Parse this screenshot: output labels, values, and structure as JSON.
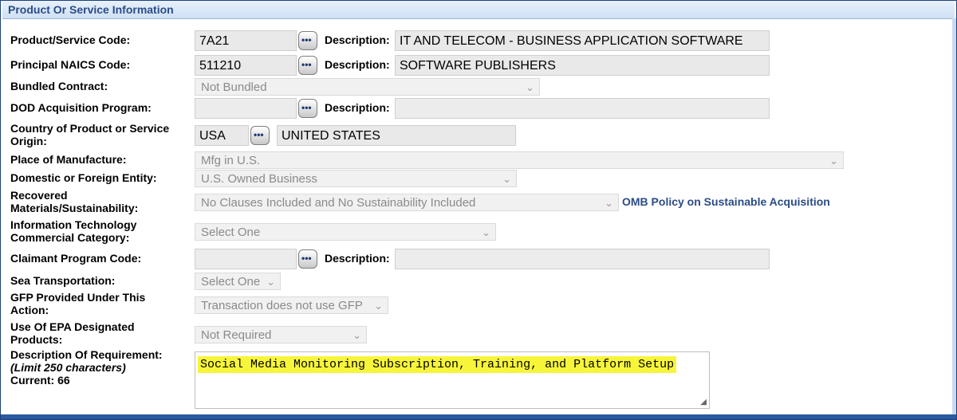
{
  "section": {
    "title": "Product Or Service Information"
  },
  "psc": {
    "label": "Product/Service Code:",
    "value": "7A21",
    "desc_label": "Description:",
    "desc": "IT AND TELECOM - BUSINESS APPLICATION SOFTWARE"
  },
  "naics": {
    "label": "Principal NAICS Code:",
    "value": "511210",
    "desc_label": "Description:",
    "desc": "SOFTWARE PUBLISHERS"
  },
  "bundled": {
    "label": "Bundled Contract:",
    "value": "Not Bundled"
  },
  "dod": {
    "label": "DOD Acquisition Program:",
    "value": "",
    "desc_label": "Description:",
    "desc": ""
  },
  "country": {
    "label_line1": "Country of Product or Service",
    "label_line2": "Origin:",
    "value": "USA",
    "desc": "UNITED STATES"
  },
  "place": {
    "label": "Place of Manufacture:",
    "value": "Mfg in U.S."
  },
  "domestic": {
    "label": "Domestic or Foreign Entity:",
    "value": "U.S. Owned Business"
  },
  "recovered": {
    "label_line1": "Recovered",
    "label_line2": "Materials/Sustainability:",
    "value": "No Clauses Included and No Sustainability Included",
    "link": "OMB Policy on Sustainable Acquisition"
  },
  "itcc": {
    "label_line1": "Information Technology",
    "label_line2": "Commercial Category:",
    "value": "Select One"
  },
  "claimant": {
    "label": "Claimant Program Code:",
    "value": "",
    "desc_label": "Description:",
    "desc": ""
  },
  "sea": {
    "label": "Sea Transportation:",
    "value": "Select One"
  },
  "gfp": {
    "label_line1": "GFP Provided Under This",
    "label_line2": "Action:",
    "value": "Transaction does not use GFP"
  },
  "epa": {
    "label_line1": "Use Of EPA Designated",
    "label_line2": "Products:",
    "value": "Not Required"
  },
  "requirement": {
    "label_line1": "Description Of Requirement:",
    "label_line2": "(Limit 250 characters)",
    "label_line3": "Current: 66",
    "value": "Social Media Monitoring Subscription, Training, and Platform Setup"
  },
  "icons": {
    "lookup": "ellipsis-lookup-icon",
    "dropdown": "chevron-down-icon",
    "resize": "resize-grip-icon"
  },
  "colors": {
    "header_text": "#2b4c86",
    "highlight": "#f7f53a",
    "frame": "#1c3f7a"
  }
}
